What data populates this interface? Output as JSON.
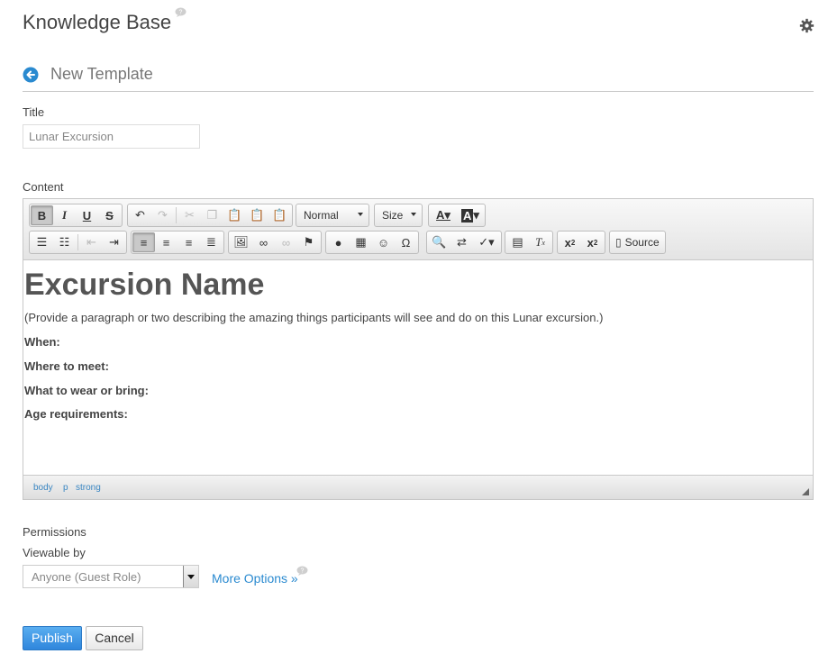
{
  "header": {
    "portlet_title": "Knowledge Base",
    "page_heading": "New Template"
  },
  "form": {
    "title_label": "Title",
    "title_value": "Lunar Excursion",
    "content_label": "Content"
  },
  "editor": {
    "format_combo": "Normal",
    "size_combo": "Size",
    "source_label": "Source",
    "body": {
      "heading": "Excursion Name",
      "paragraph": "(Provide a paragraph or two describing the amazing things participants will see and do on this Lunar excursion.)",
      "fields": [
        "When:",
        "Where to meet:",
        "What to wear or bring:",
        "Age requirements:"
      ]
    },
    "path": [
      "body",
      "p",
      "strong"
    ]
  },
  "permissions": {
    "label": "Permissions",
    "viewable_label": "Viewable by",
    "selected": "Anyone (Guest Role)",
    "more_options": "More Options »"
  },
  "actions": {
    "publish": "Publish",
    "cancel": "Cancel"
  },
  "colors": {
    "accent": "#2a8ad0",
    "publish_bg": "#3a8fe0"
  }
}
